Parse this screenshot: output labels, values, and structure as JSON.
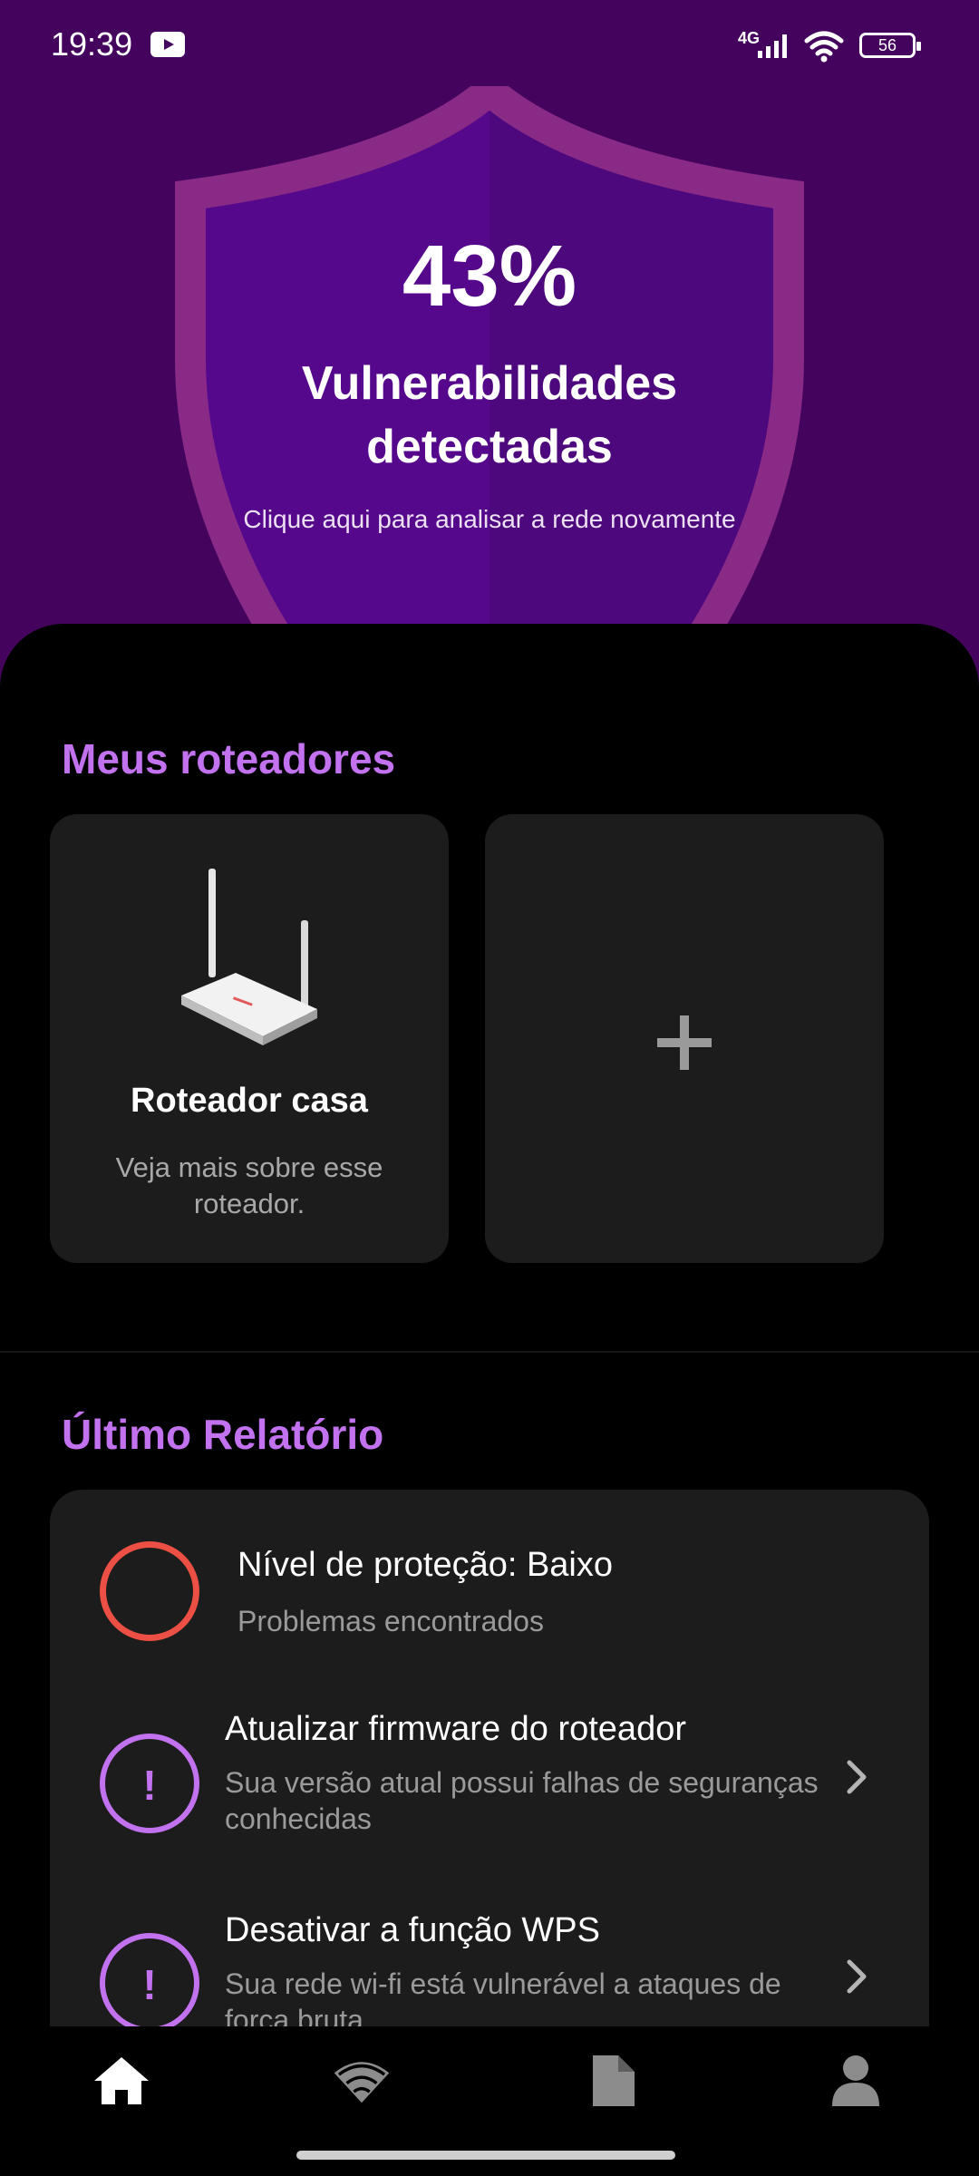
{
  "status_bar": {
    "time": "19:39",
    "network": "4G",
    "battery": "56"
  },
  "hero": {
    "percent": "43%",
    "title": "Vulnerabilidades detectadas",
    "subtitle": "Clique aqui para analisar a rede novamente"
  },
  "routers": {
    "section_title": "Meus roteadores",
    "items": [
      {
        "name": "Roteador casa",
        "description": "Veja mais sobre esse roteador."
      }
    ],
    "add_label": "+"
  },
  "report": {
    "section_title": "Último Relatório",
    "items": [
      {
        "title": "Nível de proteção: Baixo",
        "subtitle": "Problemas encontrados"
      },
      {
        "icon_text": "!",
        "title": "Atualizar firmware do roteador",
        "subtitle": "Sua versão atual possui falhas de seguranças conhecidas"
      },
      {
        "icon_text": "!",
        "title": "Desativar a função WPS",
        "subtitle": "Sua rede wi-fi está vulnerável a ataques de força bruta"
      }
    ]
  },
  "nav": {
    "items": [
      {
        "icon": "home-icon"
      },
      {
        "icon": "wifi-icon"
      },
      {
        "icon": "document-icon"
      },
      {
        "icon": "profile-icon"
      }
    ]
  },
  "colors": {
    "hero_bg": "#44045e",
    "shield": "#8a2a87",
    "accent": "#c271ef",
    "danger": "#ec4f44",
    "card": "#1c1c1c"
  }
}
